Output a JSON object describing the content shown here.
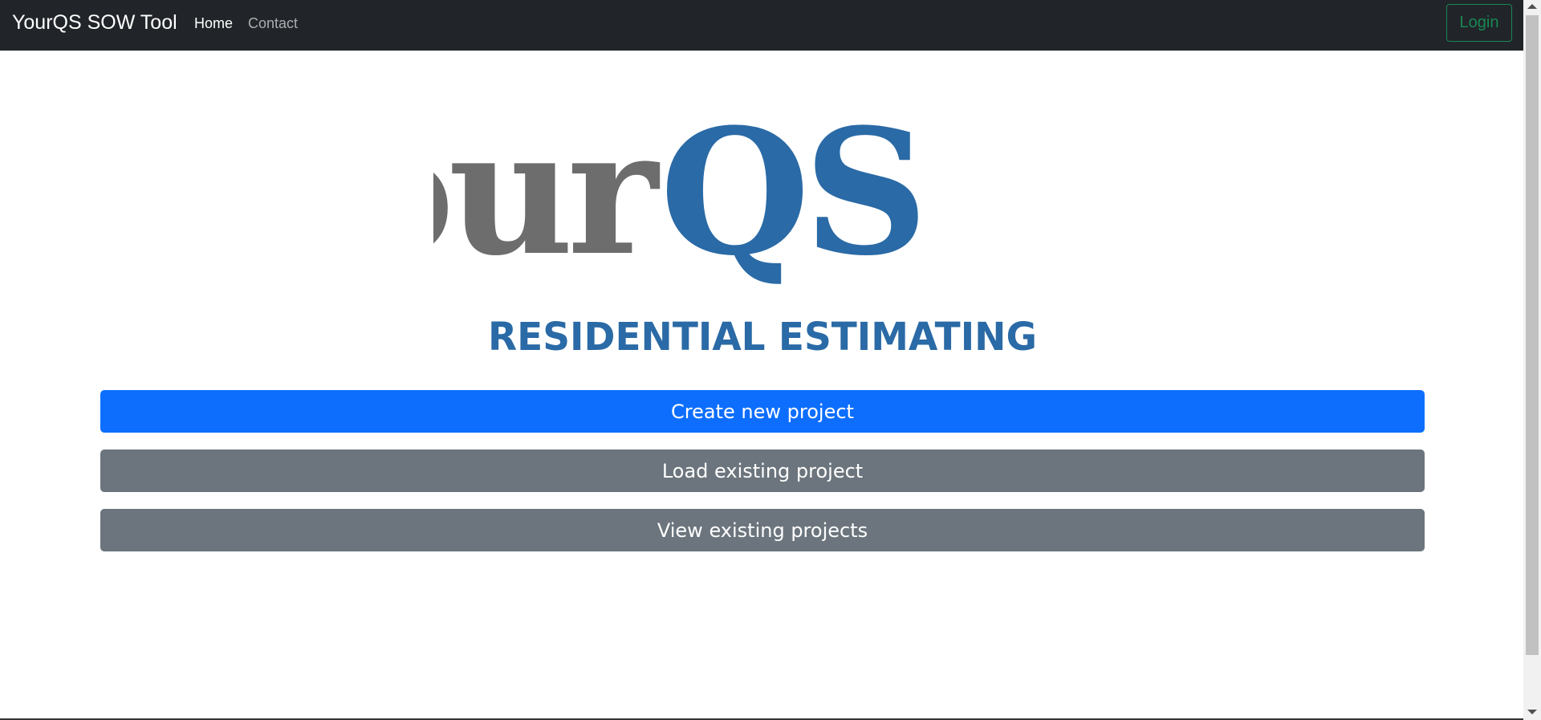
{
  "navbar": {
    "brand": "YourQS SOW Tool",
    "links": [
      {
        "label": "Home",
        "active": true
      },
      {
        "label": "Contact",
        "active": false
      }
    ],
    "login_label": "Login",
    "colors": {
      "background": "#212529",
      "login_outline": "#198754"
    }
  },
  "logo": {
    "word_left": "Your",
    "word_right": "QS",
    "tagline": "RESIDENTIAL ESTIMATING",
    "colors": {
      "grey": "#6d6d6d",
      "blue": "#2a6aa6"
    }
  },
  "actions": {
    "create_label": "Create new project",
    "load_label": "Load existing project",
    "view_label": "View existing projects",
    "colors": {
      "primary": "#0d6efd",
      "secondary": "#6c757d"
    }
  },
  "scrollbar": {
    "up_icon": "arrow-up-icon",
    "down_icon": "arrow-down-icon"
  }
}
